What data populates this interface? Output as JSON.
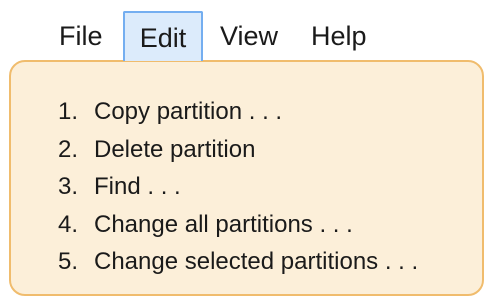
{
  "menubar": {
    "items": [
      {
        "label": "File"
      },
      {
        "label": "Edit",
        "active": true
      },
      {
        "label": "View"
      },
      {
        "label": "Help"
      }
    ]
  },
  "dropdown": {
    "items": [
      {
        "number": "1.",
        "label": "Copy partition . . ."
      },
      {
        "number": "2.",
        "label": "Delete partition"
      },
      {
        "number": "3.",
        "label": "Find . . ."
      },
      {
        "number": "4.",
        "label": "Change all partitions . . ."
      },
      {
        "number": "5.",
        "label": "Change selected partitions . . ."
      }
    ]
  },
  "colors": {
    "active_menu_fill": "#dcebfb",
    "active_menu_border": "#74aef0",
    "dropdown_fill": "#fcefd9",
    "dropdown_border": "#f0bc6d"
  }
}
